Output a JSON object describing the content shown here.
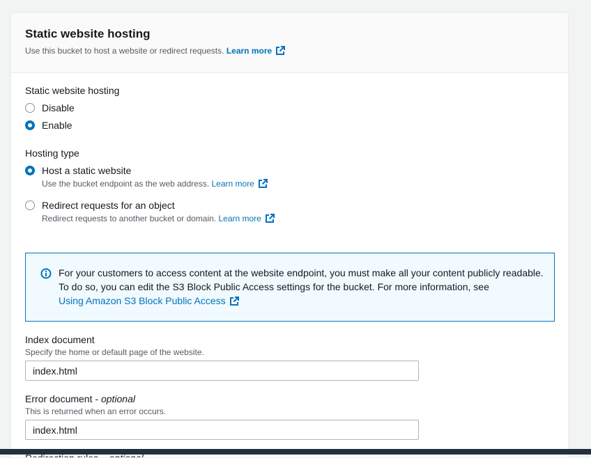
{
  "panel": {
    "title": "Static website hosting",
    "description": "Use this bucket to host a website or redirect requests.",
    "learn_more": "Learn more"
  },
  "hosting": {
    "label": "Static website hosting",
    "options": [
      {
        "label": "Disable",
        "selected": false
      },
      {
        "label": "Enable",
        "selected": true
      }
    ]
  },
  "hosting_type": {
    "label": "Hosting type",
    "options": [
      {
        "label": "Host a static website",
        "description": "Use the bucket endpoint as the web address.",
        "learn_more": "Learn more",
        "selected": true
      },
      {
        "label": "Redirect requests for an object",
        "description": "Redirect requests to another bucket or domain.",
        "learn_more": "Learn more",
        "selected": false
      }
    ]
  },
  "alert": {
    "text": "For your customers to access content at the website endpoint, you must make all your content publicly readable. To do so, you can edit the S3 Block Public Access settings for the bucket. For more information, see",
    "link": "Using Amazon S3 Block Public Access"
  },
  "index_document": {
    "label": "Index document",
    "description": "Specify the home or default page of the website.",
    "value": "index.html"
  },
  "error_document": {
    "label": "Error document - ",
    "optional": "optional",
    "description": "This is returned when an error occurs.",
    "value": "index.html"
  },
  "redirection_rules": {
    "label": "Redirection rules – ",
    "optional": "optional"
  },
  "colors": {
    "link": "#0073bb",
    "selected_radio": "#0073bb",
    "alert_background": "#f1faff"
  },
  "icons": {
    "external_link": "external-link-icon",
    "info": "info-icon"
  }
}
